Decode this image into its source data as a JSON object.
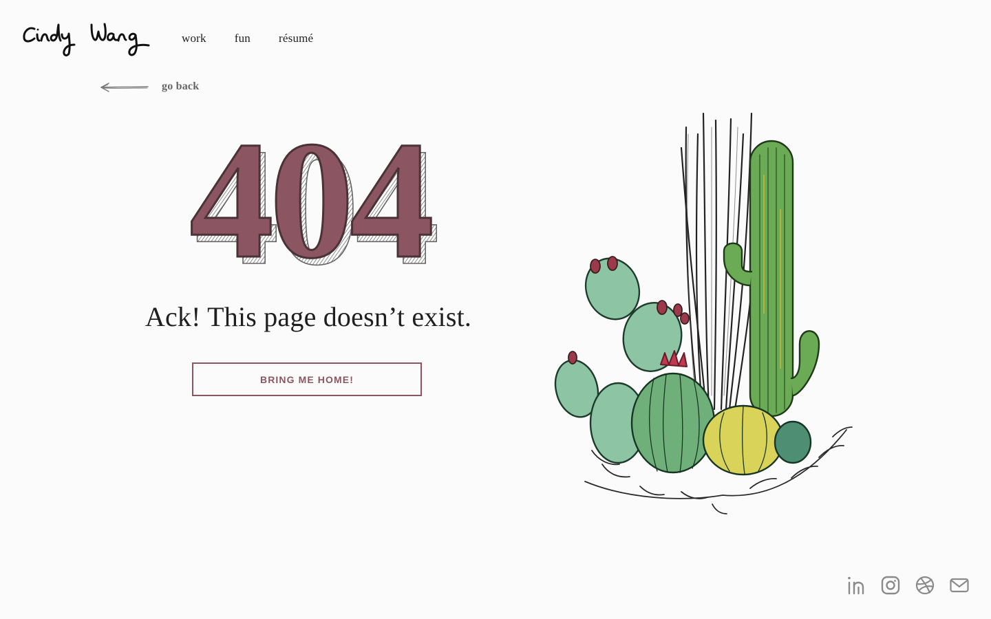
{
  "header": {
    "logo_text": "Cindy Wang",
    "nav": [
      {
        "label": "work"
      },
      {
        "label": "fun"
      },
      {
        "label": "résumé"
      }
    ]
  },
  "back_link": {
    "label": "go back",
    "icon": "arrow-left-icon"
  },
  "error": {
    "code": "404",
    "message": "Ack! This page doesn’t exist.",
    "button_label": "BRING ME HOME!"
  },
  "illustration": {
    "icon": "cactus-illustration"
  },
  "social": [
    {
      "icon": "linkedin-icon"
    },
    {
      "icon": "instagram-icon"
    },
    {
      "icon": "dribbble-icon"
    },
    {
      "icon": "mail-icon"
    }
  ],
  "colors": {
    "accent": "#8b5561",
    "background": "#fbfbfb",
    "text": "#1f1f1f",
    "icon_gray": "#8a8a8a"
  }
}
